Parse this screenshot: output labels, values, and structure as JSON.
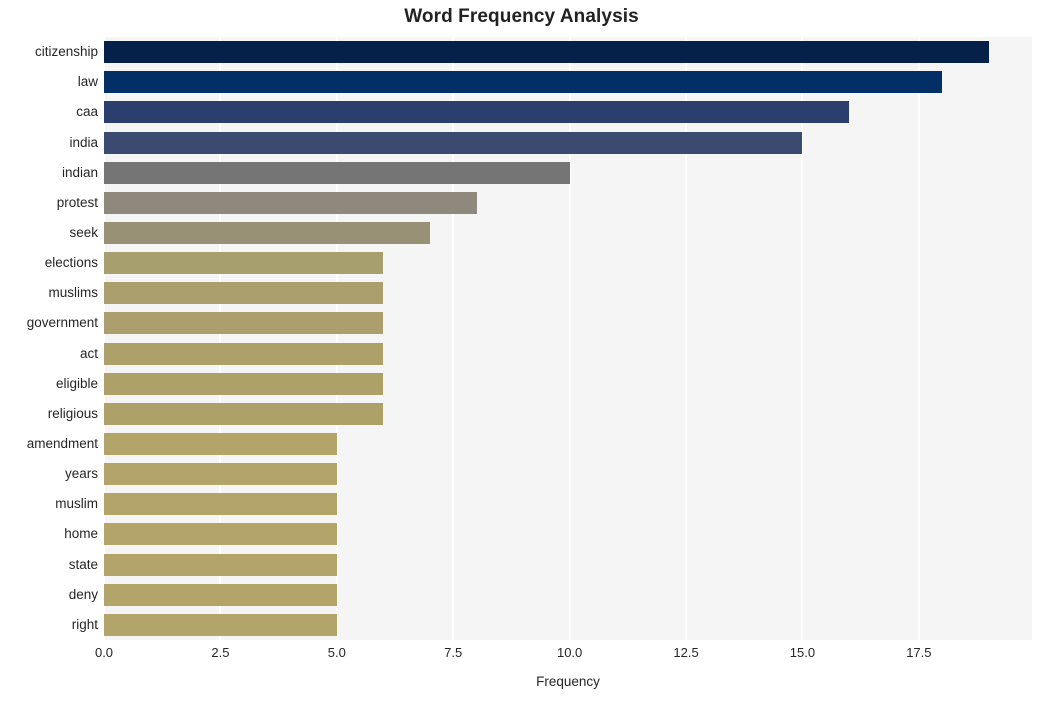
{
  "chart_data": {
    "type": "bar",
    "orientation": "horizontal",
    "title": "Word Frequency Analysis",
    "xlabel": "Frequency",
    "ylabel": "",
    "categories": [
      "citizenship",
      "law",
      "caa",
      "india",
      "indian",
      "protest",
      "seek",
      "elections",
      "muslims",
      "government",
      "act",
      "eligible",
      "religious",
      "amendment",
      "years",
      "muslim",
      "home",
      "state",
      "deny",
      "right"
    ],
    "values": [
      19,
      18,
      16,
      15,
      10,
      8,
      7,
      6,
      6,
      6,
      6,
      6,
      6,
      5,
      5,
      5,
      5,
      5,
      5,
      5
    ],
    "bar_colors": [
      "#05214a",
      "#023066",
      "#2b3f6e",
      "#3a4a70",
      "#757575",
      "#8e897c",
      "#989176",
      "#a89f6f",
      "#ab9f6d",
      "#ad9f6d",
      "#ada069",
      "#ada069",
      "#ada069",
      "#b3a469",
      "#b3a469",
      "#b3a469",
      "#b3a469",
      "#b3a469",
      "#b3a469",
      "#b3a469"
    ],
    "xticks": [
      "0.0",
      "2.5",
      "5.0",
      "7.5",
      "10.0",
      "12.5",
      "15.0",
      "17.5"
    ],
    "xtick_values": [
      0,
      2.5,
      5,
      7.5,
      10,
      12.5,
      15,
      17.5
    ],
    "xlim": [
      0,
      19.93
    ],
    "grid": true,
    "grid_axis": "x",
    "legend": "none",
    "plot_background": "#f5f5f5",
    "figure_background": "#ffffff",
    "gridline_color": "#ffffff"
  }
}
